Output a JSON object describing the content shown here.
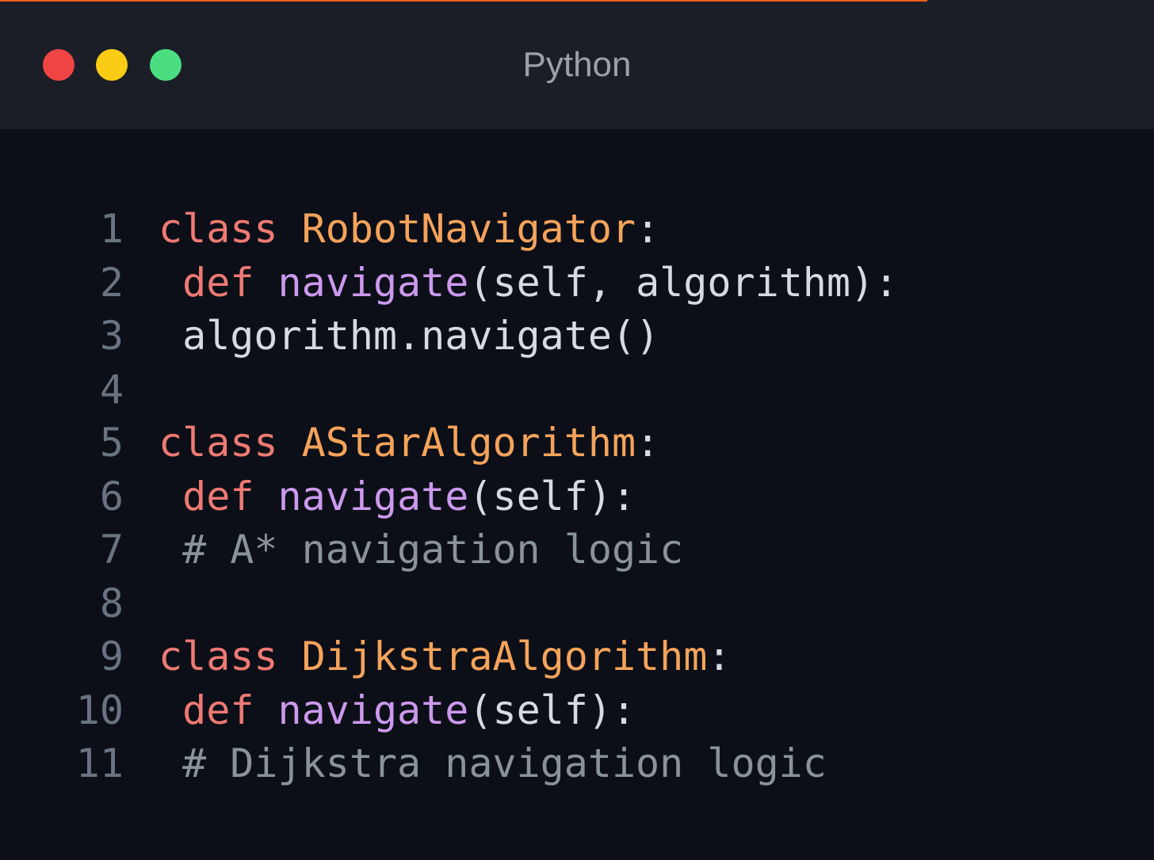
{
  "window": {
    "title": "Python",
    "colors": {
      "accent_line": "#e8611c",
      "close": "#ef4444",
      "minimize": "#facc15",
      "maximize": "#4ade80"
    }
  },
  "syntax_colors": {
    "keyword": "#ee7a73",
    "classname": "#f5a35b",
    "function": "#cc99ee",
    "plain": "#d6dae2",
    "comment": "#8a929c"
  },
  "code": {
    "language": "Python",
    "lines": [
      {
        "number": "1",
        "tokens": [
          {
            "t": "class",
            "k": "keyword"
          },
          {
            "t": " "
          },
          {
            "t": "RobotNavigator",
            "k": "classname"
          },
          {
            "t": ":"
          }
        ]
      },
      {
        "number": "2",
        "tokens": [
          {
            "t": " "
          },
          {
            "t": "def",
            "k": "keyword"
          },
          {
            "t": " "
          },
          {
            "t": "navigate",
            "k": "function"
          },
          {
            "t": "(self, algorithm):"
          }
        ]
      },
      {
        "number": "3",
        "tokens": [
          {
            "t": " algorithm.navigate()"
          }
        ]
      },
      {
        "number": "4",
        "tokens": []
      },
      {
        "number": "5",
        "tokens": [
          {
            "t": "class",
            "k": "keyword"
          },
          {
            "t": " "
          },
          {
            "t": "AStarAlgorithm",
            "k": "classname"
          },
          {
            "t": ":"
          }
        ]
      },
      {
        "number": "6",
        "tokens": [
          {
            "t": " "
          },
          {
            "t": "def",
            "k": "keyword"
          },
          {
            "t": " "
          },
          {
            "t": "navigate",
            "k": "function"
          },
          {
            "t": "(self):"
          }
        ]
      },
      {
        "number": "7",
        "tokens": [
          {
            "t": " # A* navigation logic",
            "k": "comment"
          }
        ]
      },
      {
        "number": "8",
        "tokens": []
      },
      {
        "number": "9",
        "tokens": [
          {
            "t": "class",
            "k": "keyword"
          },
          {
            "t": " "
          },
          {
            "t": "DijkstraAlgorithm",
            "k": "classname"
          },
          {
            "t": ":"
          }
        ]
      },
      {
        "number": "10",
        "tokens": [
          {
            "t": " "
          },
          {
            "t": "def",
            "k": "keyword"
          },
          {
            "t": " "
          },
          {
            "t": "navigate",
            "k": "function"
          },
          {
            "t": "(self):"
          }
        ]
      },
      {
        "number": "11",
        "tokens": [
          {
            "t": " # Dijkstra navigation logic",
            "k": "comment"
          }
        ]
      }
    ]
  }
}
